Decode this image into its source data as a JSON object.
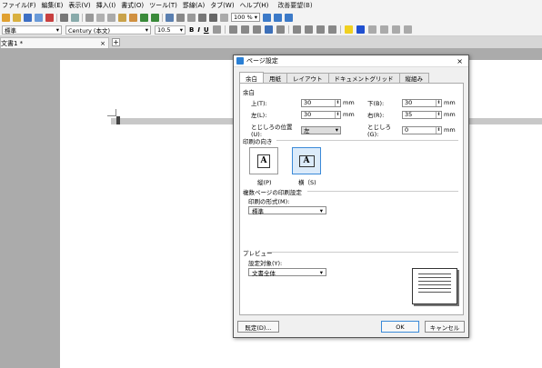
{
  "menubar": {
    "items": [
      "ファイル(F)",
      "編集(E)",
      "表示(V)",
      "挿入(I)",
      "書式(O)",
      "ツール(T)",
      "罫線(A)",
      "タブ(W)",
      "ヘルプ(H)"
    ],
    "special": "改善要望(B)"
  },
  "toolbar": {
    "zoom": "100 %"
  },
  "format_bar": {
    "style": "標準",
    "font": "Century (本文)",
    "size": "10.5",
    "bold": "B",
    "italic": "I",
    "underline": "U"
  },
  "document_tab": {
    "title": "文書1 *",
    "close": "×",
    "add": "+"
  },
  "dialog": {
    "title": "ページ設定",
    "close": "×",
    "tabs": [
      "余白",
      "用紙",
      "レイアウト",
      "ドキュメントグリッド",
      "縦組み"
    ],
    "active_tab": 0,
    "margins": {
      "section_label": "余白",
      "top_label": "上(T):",
      "top_value": "30",
      "bottom_label": "下(B):",
      "bottom_value": "30",
      "left_label": "左(L):",
      "left_value": "30",
      "right_label": "右(R):",
      "right_value": "35",
      "gutter_pos_label": "とじしろの位置(U):",
      "gutter_pos_value": "左",
      "gutter_label": "とじしろ(G):",
      "gutter_value": "0",
      "unit": "mm"
    },
    "orientation": {
      "section_label": "印刷の向き",
      "portrait": "縦(P)",
      "landscape": "横（S)",
      "glyph": "A",
      "selected": "landscape"
    },
    "multi_page": {
      "section_label": "複数ページの印刷設定",
      "format_label": "印刷の形式(M):",
      "format_value": "標準"
    },
    "preview": {
      "section_label": "プレビュー",
      "apply_label": "設定対象(Y):",
      "apply_value": "文書全体"
    },
    "buttons": {
      "default": "既定(D)...",
      "ok": "OK",
      "cancel": "キャンセル"
    }
  }
}
